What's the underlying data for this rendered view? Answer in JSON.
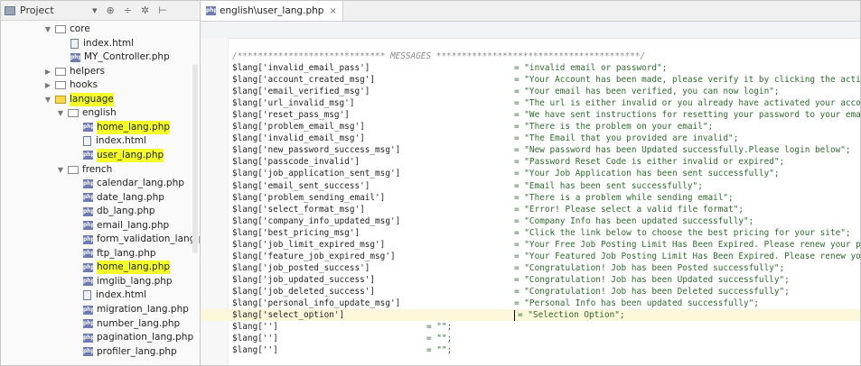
{
  "project_panel": {
    "title": "Project",
    "dropdown_icon": "chevron-down-icon",
    "tools": [
      "⊕",
      "÷",
      "✲",
      "⊢"
    ]
  },
  "tree": [
    {
      "label": "core",
      "type": "folder",
      "expanded": true,
      "depth": 1,
      "hl": false
    },
    {
      "label": "index.html",
      "type": "html",
      "depth": 2,
      "hl": false
    },
    {
      "label": "MY_Controller.php",
      "type": "php",
      "depth": 2,
      "hl": false
    },
    {
      "label": "helpers",
      "type": "folder",
      "expanded": false,
      "depth": 1,
      "hl": false
    },
    {
      "label": "hooks",
      "type": "folder",
      "expanded": false,
      "depth": 1,
      "hl": false
    },
    {
      "label": "language",
      "type": "folder",
      "expanded": true,
      "depth": 1,
      "hl": true,
      "yellow": true
    },
    {
      "label": "english",
      "type": "folder",
      "expanded": true,
      "depth": 2,
      "hl": false
    },
    {
      "label": "home_lang.php",
      "type": "php",
      "depth": 3,
      "hl": true
    },
    {
      "label": "index.html",
      "type": "html",
      "depth": 3,
      "hl": false
    },
    {
      "label": "user_lang.php",
      "type": "php",
      "depth": 3,
      "hl": true
    },
    {
      "label": "french",
      "type": "folder",
      "expanded": true,
      "depth": 2,
      "hl": false
    },
    {
      "label": "calendar_lang.php",
      "type": "php",
      "depth": 3,
      "hl": false
    },
    {
      "label": "date_lang.php",
      "type": "php",
      "depth": 3,
      "hl": false
    },
    {
      "label": "db_lang.php",
      "type": "php",
      "depth": 3,
      "hl": false
    },
    {
      "label": "email_lang.php",
      "type": "php",
      "depth": 3,
      "hl": false
    },
    {
      "label": "form_validation_lang.php",
      "type": "php",
      "depth": 3,
      "hl": false
    },
    {
      "label": "ftp_lang.php",
      "type": "php",
      "depth": 3,
      "hl": false
    },
    {
      "label": "home_lang.php",
      "type": "php",
      "depth": 3,
      "hl": true
    },
    {
      "label": "imglib_lang.php",
      "type": "php",
      "depth": 3,
      "hl": false
    },
    {
      "label": "index.html",
      "type": "html",
      "depth": 3,
      "hl": false
    },
    {
      "label": "migration_lang.php",
      "type": "php",
      "depth": 3,
      "hl": false
    },
    {
      "label": "number_lang.php",
      "type": "php",
      "depth": 3,
      "hl": false
    },
    {
      "label": "pagination_lang.php",
      "type": "php",
      "depth": 3,
      "hl": false
    },
    {
      "label": "profiler_lang.php",
      "type": "php",
      "depth": 3,
      "hl": false
    }
  ],
  "editor": {
    "tab_label": "english\\user_lang.php",
    "tab_close": "×",
    "comment_line": "/***************************** MESSAGES ****************************************/",
    "lines": [
      {
        "key": "$lang['invalid_email_pass']",
        "val": "= \"invalid email or password\";"
      },
      {
        "key": "$lang['account_created_msg']",
        "val": "= \"Your Account has been made, please verify it by clicking the activ"
      },
      {
        "key": "$lang['email_verified_msg']",
        "val": "= \"Your email has been verified, you can now login\";"
      },
      {
        "key": "$lang['url_invalid_msg']",
        "val": "= \"The url is either invalid or you already have activated your accou"
      },
      {
        "key": "$lang['reset_pass_msg']",
        "val": "= \"We have sent instructions for resetting your password to your emai"
      },
      {
        "key": "$lang['problem_email_msg']",
        "val": "= \"There is the problem on your email\";"
      },
      {
        "key": "$lang['invalid_email_msg']",
        "val": "= \"The Email that you provided are invalid\";"
      },
      {
        "key": "$lang['new_password_success_msg']",
        "val": "= \"New password has been Updated successfully.Please login below\";"
      },
      {
        "key": "$lang['passcode_invalid']",
        "val": "= \"Password Reset Code is either invalid or expired\";"
      },
      {
        "key": "$lang['job_application_sent_msg']",
        "val": "= \"Your Job Application has been sent successfully\";"
      },
      {
        "key": "$lang['email_sent_success']",
        "val": "= \"Email has been sent successfully\";"
      },
      {
        "key": "$lang['problem_sending_email']",
        "val": "= \"There is a problem while sending email\";"
      },
      {
        "key": "$lang['select_format_msg']",
        "val": "= \"Error! Please select a valid file format\";"
      },
      {
        "key": "$lang['company_info_updated_msg']",
        "val": "= \"Company Info has been updated successfully\";"
      },
      {
        "key": "$lang['best_pricing_msg']",
        "val": "= \"Click the link below to choose the best pricing for your site\";"
      },
      {
        "key": "$lang['job_limit_expired_msg']",
        "val": "= \"Your Free Job Posting Limit Has Been Expired. Please renew your pa"
      },
      {
        "key": "$lang['feature_job_expired_msg']",
        "val": "= \"Your Featured Job Posting Limit Has Been Expired. Please renew you"
      },
      {
        "key": "$lang['job_posted_success']",
        "val": "= \"Congratulation! Job has been Posted successfully\";"
      },
      {
        "key": "$lang['job_updated_success']",
        "val": "= \"Congratulation! Job has been Updated successfully\";"
      },
      {
        "key": "$lang['job_deleted_success']",
        "val": "= \"Congratulation! Job has been Deleted successfully\";"
      },
      {
        "key": "$lang['personal_info_update_msg']",
        "val": "= \"Personal Info has been updated successfully\";"
      },
      {
        "key": "$lang['select_option']",
        "val": "= \"Selection Option\";",
        "current": true
      }
    ],
    "blank_lines": [
      {
        "key": "$lang['']",
        "val": "= \"\";"
      },
      {
        "key": "$lang['']",
        "val": "= \"\";"
      },
      {
        "key": "$lang['']",
        "val": "= \"\";"
      }
    ]
  }
}
